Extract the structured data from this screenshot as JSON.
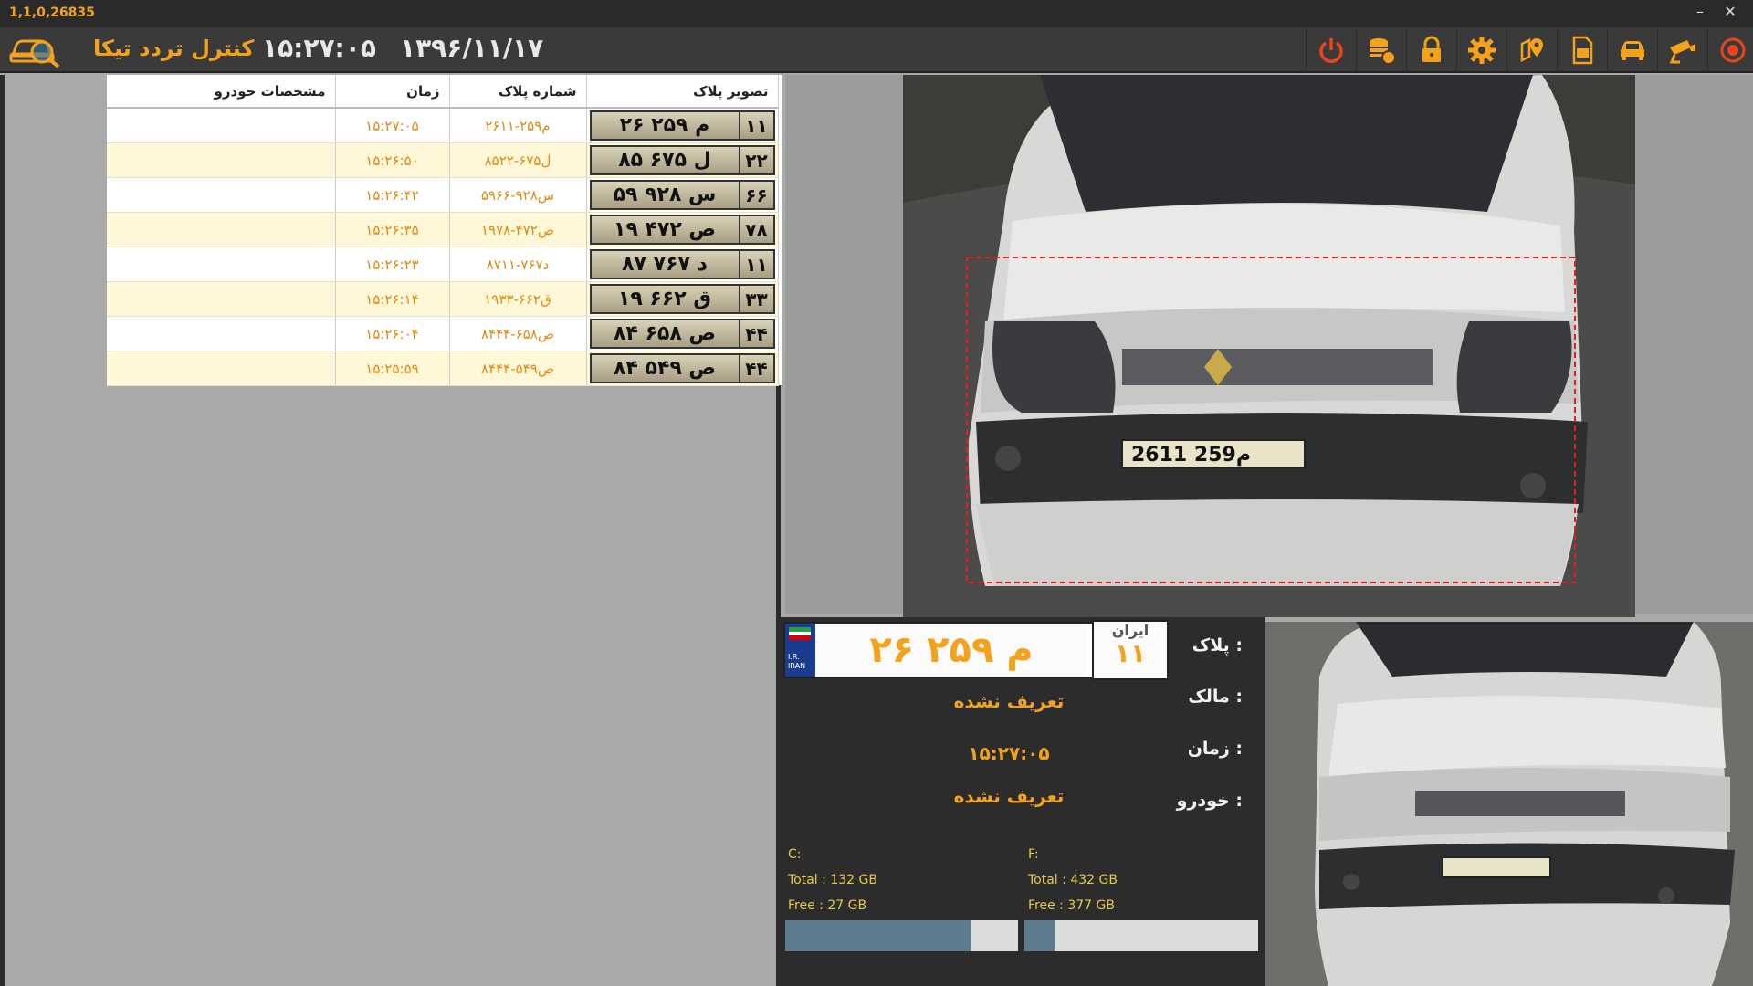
{
  "window": {
    "version": "1,1,0,26835",
    "minimize": "–",
    "close": "✕"
  },
  "toolbar": {
    "app_title": "کنترل تردد تیکا",
    "clock": "۱۵:۲۷:۰۵",
    "date": "۱۳۹۶/۱۱/۱۷",
    "buttons": [
      "power-icon",
      "database-icon",
      "lock-icon",
      "gear-icon",
      "map-pin-icon",
      "report-icon",
      "car-icon",
      "camera-icon",
      "stop-icon"
    ],
    "accent": "#f4a21c"
  },
  "grid": {
    "headers": {
      "image": "تصویر پلاک",
      "plate": "شماره پلاک",
      "time": "زمان",
      "vehicle": "مشخصات خودرو"
    },
    "rows": [
      {
        "img_main": "۲۶ م ۲۵۹",
        "img_code": "۱۱",
        "plate": "۲۶م۲۵۹-۱۱",
        "time": "۱۵:۲۷:۰۵",
        "vehicle": ""
      },
      {
        "img_main": "۸۵ ل ۶۷۵",
        "img_code": "۲۲",
        "plate": "۸۵ل۶۷۵-۲۲",
        "time": "۱۵:۲۶:۵۰",
        "vehicle": ""
      },
      {
        "img_main": "۵۹ س ۹۲۸",
        "img_code": "۶۶",
        "plate": "۵۹س۹۲۸-۶۶",
        "time": "۱۵:۲۶:۴۲",
        "vehicle": ""
      },
      {
        "img_main": "۱۹ ص ۴۷۲",
        "img_code": "۷۸",
        "plate": "۱۹ص۴۷۲-۷۸",
        "time": "۱۵:۲۶:۳۵",
        "vehicle": ""
      },
      {
        "img_main": "۸۷ د ۷۶۷",
        "img_code": "۱۱",
        "plate": "۸۷د۷۶۷-۱۱",
        "time": "۱۵:۲۶:۲۳",
        "vehicle": ""
      },
      {
        "img_main": "۱۹ ق ۶۶۲",
        "img_code": "۳۳",
        "plate": "۱۹ق۶۶۲-۳۳",
        "time": "۱۵:۲۶:۱۴",
        "vehicle": ""
      },
      {
        "img_main": "۸۴ ص ۶۵۸",
        "img_code": "۴۴",
        "plate": "۸۴ص۶۵۸-۴۴",
        "time": "۱۵:۲۶:۰۴",
        "vehicle": ""
      },
      {
        "img_main": "۸۴ ص ۵۴۹",
        "img_code": "۴۴",
        "plate": "۸۴ص۵۴۹-۴۴",
        "time": "۱۵:۲۵:۵۹",
        "vehicle": ""
      }
    ]
  },
  "detail": {
    "plate_main": "۲۶ م ۲۵۹",
    "plate_region_title": "ایران",
    "plate_region_code": "۱۱",
    "plate_country": "I.R. IRAN",
    "label_plate": "پلاک :",
    "label_owner": "مالک :",
    "label_time": "زمان :",
    "label_vehicle": "خودرو :",
    "owner": "تعریف نشده",
    "time": "۱۵:۲۷:۰۵",
    "vehicle": "تعریف نشده"
  },
  "disks": [
    {
      "name": "C:",
      "total": "Total : 132 GB",
      "free": "Free : 27 GB",
      "used_fraction": 0.795
    },
    {
      "name": "F:",
      "total": "Total : 432 GB",
      "free": "Free : 377 GB",
      "used_fraction": 0.127
    }
  ]
}
